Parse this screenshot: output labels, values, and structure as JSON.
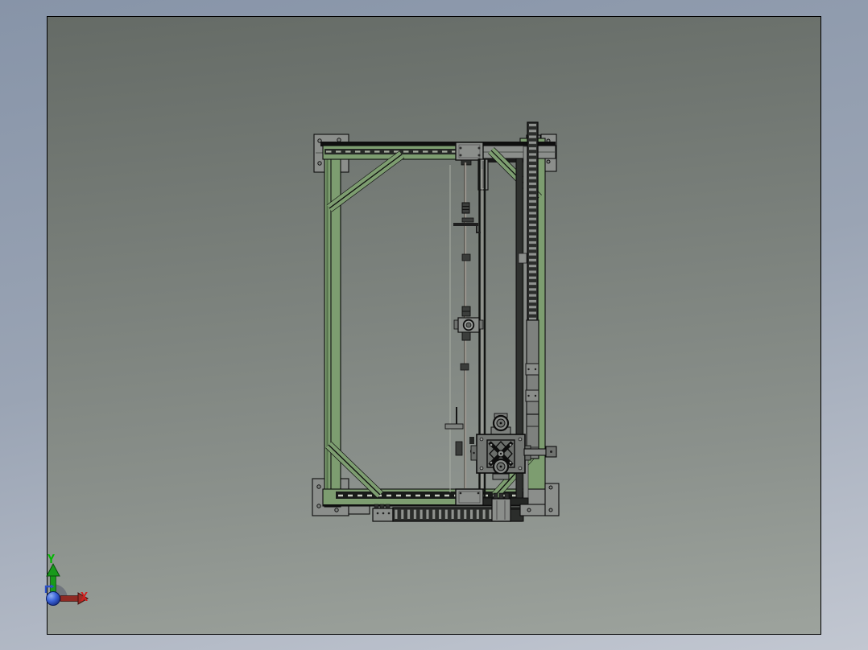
{
  "triad": {
    "x_label": "X",
    "y_label": "Y"
  },
  "colors": {
    "outer_bg_top": "#8794a8",
    "outer_bg_mid": "#9aa4b4",
    "outer_bg_bottom": "#c2c7d1",
    "viewport_bg_top": "#656b66",
    "viewport_bg_mid": "#7b817c",
    "viewport_bg_bottom": "#9da39d",
    "frame_green": "#7d9d70",
    "frame_green_dark": "#56734d",
    "plate_gray": "#8b8e8b",
    "machined_gray": "#747774",
    "outline_black": "#0d0d0d",
    "axis_x_red": "#d01f1f",
    "axis_x_shaft": "#8e2a23",
    "axis_y_green": "#00b800",
    "axis_y_shaft": "#189a1b",
    "axis_z_blue": "#2e52c8",
    "origin_sphere_blue": "#1b3fae"
  }
}
